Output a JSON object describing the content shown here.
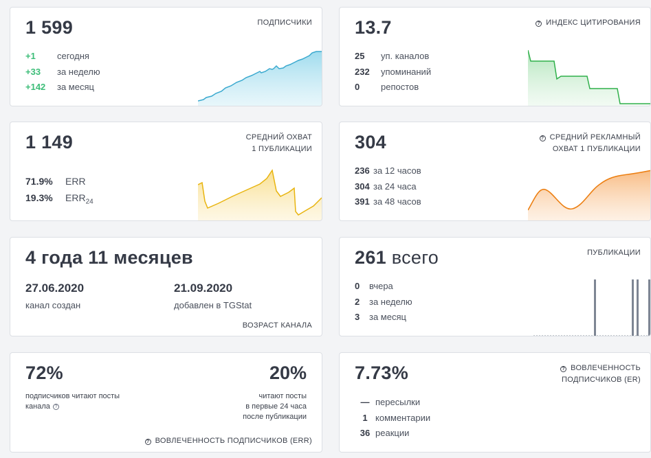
{
  "subscribers": {
    "value": "1 599",
    "label": "ПОДПИСЧИКИ",
    "rows": [
      {
        "v": "+1",
        "t": "сегодня"
      },
      {
        "v": "+33",
        "t": "за неделю"
      },
      {
        "v": "+142",
        "t": "за месяц"
      }
    ],
    "spark_color": "#5fc0dc"
  },
  "citation": {
    "value": "13.7",
    "label": "ИНДЕКС ЦИТИРОВАНИЯ",
    "icon": "question-circle-icon",
    "rows": [
      {
        "v": "25",
        "t": "уп. каналов"
      },
      {
        "v": "232",
        "t": "упоминаний"
      },
      {
        "v": "0",
        "t": "репостов"
      }
    ],
    "spark_color": "#3cbd5a"
  },
  "avg_reach": {
    "value": "1 149",
    "label_line1": "СРЕДНИЙ ОХВАТ",
    "label_line2": "1 ПУБЛИКАЦИИ",
    "rows": [
      {
        "v": "71.9%",
        "t": "ERR"
      },
      {
        "v": "19.3%",
        "t": "ERR",
        "sub": "24"
      }
    ],
    "spark_color": "#f2c12e"
  },
  "ad_reach": {
    "value": "304",
    "label_line1": "СРЕДНИЙ РЕКЛАМНЫЙ",
    "label_line2": "ОХВАТ 1 ПУБЛИКАЦИИ",
    "icon": "question-circle-icon",
    "rows": [
      {
        "v": "236",
        "t": "за 12 часов"
      },
      {
        "v": "304",
        "t": "за 24 часа"
      },
      {
        "v": "391",
        "t": "за 48 часов"
      }
    ],
    "spark_color": "#f08a1e"
  },
  "age": {
    "value": "4 года 11 месяцев",
    "created_date": "27.06.2020",
    "created_label": "канал создан",
    "added_date": "21.09.2020",
    "added_label": "добавлен в TGStat",
    "label": "ВОЗРАСТ КАНАЛА"
  },
  "posts": {
    "value": "261",
    "value_suffix": "всего",
    "label": "ПУБЛИКАЦИИ",
    "rows": [
      {
        "v": "0",
        "t": "вчера"
      },
      {
        "v": "2",
        "t": "за неделю"
      },
      {
        "v": "3",
        "t": "за месяц"
      }
    ],
    "bar_color": "#7d8593"
  },
  "engagement_err": {
    "value1": "72%",
    "text1_line1": "подписчиков читают посты",
    "text1_line2": "канала",
    "value2": "20%",
    "text2_line1": "читают посты",
    "text2_line2": "в первые 24 часа",
    "text2_line3": "после публикации",
    "label": "ВОВЛЕЧЕННОСТЬ ПОДПИСЧИКОВ (ERR)",
    "icon": "question-circle-icon"
  },
  "engagement_er": {
    "value": "7.73%",
    "label_line1": "ВОВЛЕЧЕННОСТЬ",
    "label_line2": "ПОДПИСЧИКОВ (ER)",
    "icon": "question-circle-icon",
    "rows": [
      {
        "v": "—",
        "t": "пересылки"
      },
      {
        "v": "1",
        "t": "комментарии"
      },
      {
        "v": "36",
        "t": "реакции"
      }
    ]
  }
}
